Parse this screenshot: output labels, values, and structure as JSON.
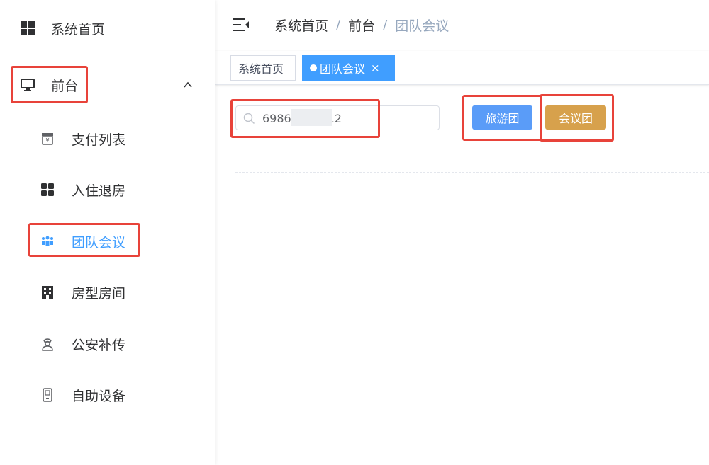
{
  "sidebar": {
    "items": [
      {
        "label": "系统首页",
        "icon": "grid-icon"
      },
      {
        "label": "前台",
        "icon": "monitor-icon",
        "expanded": true
      },
      {
        "label": "支付列表",
        "icon": "payment-icon"
      },
      {
        "label": "入住退房",
        "icon": "grid-icon"
      },
      {
        "label": "团队会议",
        "icon": "team-icon",
        "active": true
      },
      {
        "label": "房型房间",
        "icon": "building-icon"
      },
      {
        "label": "公安补传",
        "icon": "police-icon"
      },
      {
        "label": "自助设备",
        "icon": "device-icon"
      }
    ]
  },
  "header": {
    "breadcrumb": [
      "系统首页",
      "前台",
      "团队会议"
    ],
    "separator": "/"
  },
  "tags": {
    "home": "系统首页",
    "active": "团队会议",
    "close": "×"
  },
  "search": {
    "value": "6986          12",
    "placeholder": ""
  },
  "buttons": {
    "tour": "旅游团",
    "meeting": "会议团"
  },
  "colors": {
    "primary": "#409eff",
    "tour_button": "#5a9cf8",
    "meeting_button": "#d7a14c",
    "annotation": "#e8433a"
  }
}
